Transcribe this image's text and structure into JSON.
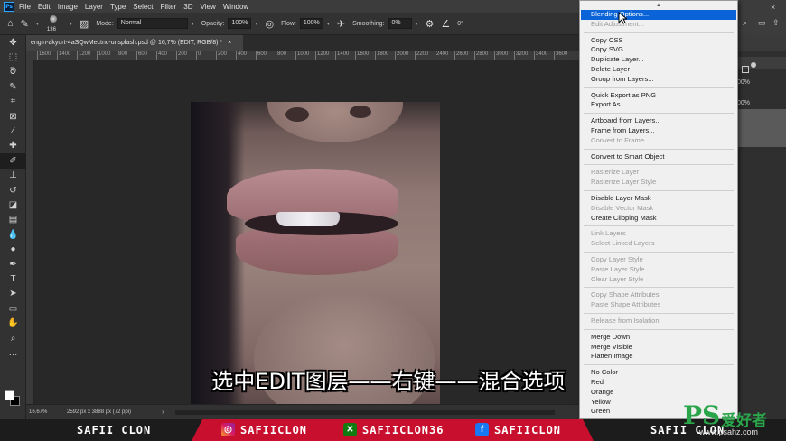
{
  "menubar": {
    "logo": "Ps",
    "items": [
      "File",
      "Edit",
      "Image",
      "Layer",
      "Type",
      "Select",
      "Filter",
      "3D",
      "View",
      "Window"
    ]
  },
  "options": {
    "brush_size": "136",
    "mode_label": "Mode:",
    "mode_value": "Normal",
    "opacity_label": "Opacity:",
    "opacity_value": "100%",
    "flow_label": "Flow:",
    "flow_value": "100%",
    "smoothing_label": "Smoothing:",
    "smoothing_value": "0%",
    "angle_value": "0°"
  },
  "document": {
    "tab_title": "engin-akyurt-4aSQwMectnc-unsplash.psd @ 16,7% (EDIT, RGB/8) *",
    "close": "×",
    "ruler_ticks": [
      "1600",
      "1400",
      "1200",
      "1000",
      "800",
      "600",
      "400",
      "200",
      "0",
      "200",
      "400",
      "600",
      "800",
      "1000",
      "1200",
      "1400",
      "1600",
      "1800",
      "2000",
      "2200",
      "2400",
      "2600",
      "2800",
      "3000",
      "3200",
      "3400",
      "3600"
    ]
  },
  "subtitle": "选中EDIT图层——右键——混合选项",
  "status": {
    "zoom": "16.67%",
    "dims": "2592 px x 3888 px (72 ppi)",
    "arrow": "›"
  },
  "context_menu": {
    "up_arrow": "▲",
    "groups": [
      [
        {
          "label": "Blending Options...",
          "state": "selected"
        },
        {
          "label": "Edit Adjustment...",
          "state": "disabled"
        }
      ],
      [
        {
          "label": "Copy CSS",
          "state": "enabled"
        },
        {
          "label": "Copy SVG",
          "state": "enabled"
        },
        {
          "label": "Duplicate Layer...",
          "state": "enabled"
        },
        {
          "label": "Delete Layer",
          "state": "enabled"
        },
        {
          "label": "Group from Layers...",
          "state": "enabled"
        }
      ],
      [
        {
          "label": "Quick Export as PNG",
          "state": "enabled"
        },
        {
          "label": "Export As...",
          "state": "enabled"
        }
      ],
      [
        {
          "label": "Artboard from Layers...",
          "state": "enabled"
        },
        {
          "label": "Frame from Layers...",
          "state": "enabled"
        },
        {
          "label": "Convert to Frame",
          "state": "disabled"
        }
      ],
      [
        {
          "label": "Convert to Smart Object",
          "state": "enabled"
        }
      ],
      [
        {
          "label": "Rasterize Layer",
          "state": "disabled"
        },
        {
          "label": "Rasterize Layer Style",
          "state": "disabled"
        }
      ],
      [
        {
          "label": "Disable Layer Mask",
          "state": "enabled"
        },
        {
          "label": "Disable Vector Mask",
          "state": "disabled"
        },
        {
          "label": "Create Clipping Mask",
          "state": "enabled"
        }
      ],
      [
        {
          "label": "Link Layers",
          "state": "disabled"
        },
        {
          "label": "Select Linked Layers",
          "state": "disabled"
        }
      ],
      [
        {
          "label": "Copy Layer Style",
          "state": "disabled"
        },
        {
          "label": "Paste Layer Style",
          "state": "disabled"
        },
        {
          "label": "Clear Layer Style",
          "state": "disabled"
        }
      ],
      [
        {
          "label": "Copy Shape Attributes",
          "state": "disabled"
        },
        {
          "label": "Paste Shape Attributes",
          "state": "disabled"
        }
      ],
      [
        {
          "label": "Release from Isolation",
          "state": "disabled"
        }
      ],
      [
        {
          "label": "Merge Down",
          "state": "enabled"
        },
        {
          "label": "Merge Visible",
          "state": "enabled"
        },
        {
          "label": "Flatten Image",
          "state": "enabled"
        }
      ],
      [
        {
          "label": "No Color",
          "state": "enabled"
        },
        {
          "label": "Red",
          "state": "enabled"
        },
        {
          "label": "Orange",
          "state": "enabled"
        },
        {
          "label": "Yellow",
          "state": "enabled"
        },
        {
          "label": "Green",
          "state": "enabled"
        }
      ]
    ]
  },
  "right_panel": {
    "pct1": "00%",
    "pct2": "00%",
    "close": "×"
  },
  "banner": {
    "left_name": "SAFII CLON",
    "instagram": "SAFIICLON",
    "xbox": "SAFIICLON36",
    "facebook": "SAFIICLON",
    "right_name": "SAFII CLON"
  },
  "watermark": {
    "ps": "PS",
    "cn": "爱好者",
    "url": "www.psahz.com"
  },
  "colors": {
    "selection": "#0a64d8",
    "banner_red": "#c8102e",
    "watermark_green": "#2aa54a"
  }
}
